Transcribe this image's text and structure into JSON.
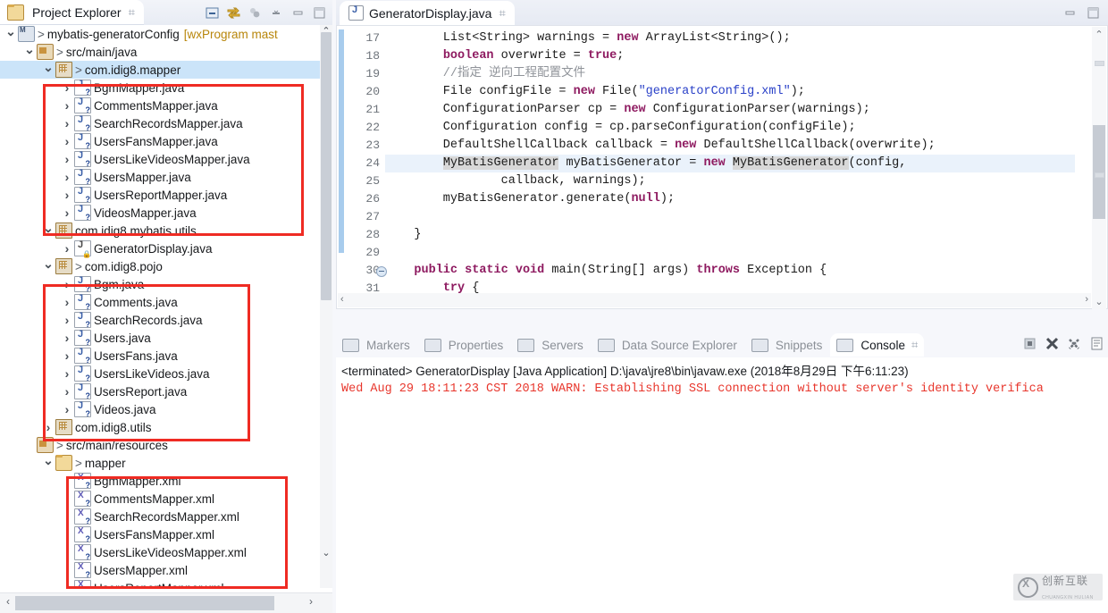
{
  "explorer": {
    "tab_title": "Project Explorer",
    "close_glyph": "⌗",
    "tools": [
      "collapse-all-icon",
      "link-with-editor-icon",
      "view-menu-icon",
      "minimize-icon",
      "maximize-icon"
    ],
    "tree": [
      {
        "label": "mybatis-generatorConfig",
        "suffix": "[wxProgram mast",
        "indent": 0,
        "arrow": "open",
        "icon": "ic-proj",
        "gt": true,
        "selected": false
      },
      {
        "label": "src/main/java",
        "suffix": "",
        "indent": 1,
        "arrow": "open",
        "icon": "ic-src",
        "gt": true,
        "selected": false
      },
      {
        "label": "com.idig8.mapper",
        "suffix": "",
        "indent": 2,
        "arrow": "open",
        "icon": "ic-pkg",
        "gt": true,
        "selected": true
      },
      {
        "label": "BgmMapper.java",
        "suffix": "",
        "indent": 3,
        "arrow": "closed",
        "icon": "ic-java",
        "gt": false,
        "selected": false
      },
      {
        "label": "CommentsMapper.java",
        "suffix": "",
        "indent": 3,
        "arrow": "closed",
        "icon": "ic-java",
        "gt": false,
        "selected": false
      },
      {
        "label": "SearchRecordsMapper.java",
        "suffix": "",
        "indent": 3,
        "arrow": "closed",
        "icon": "ic-java",
        "gt": false,
        "selected": false
      },
      {
        "label": "UsersFansMapper.java",
        "suffix": "",
        "indent": 3,
        "arrow": "closed",
        "icon": "ic-java",
        "gt": false,
        "selected": false
      },
      {
        "label": "UsersLikeVideosMapper.java",
        "suffix": "",
        "indent": 3,
        "arrow": "closed",
        "icon": "ic-java",
        "gt": false,
        "selected": false
      },
      {
        "label": "UsersMapper.java",
        "suffix": "",
        "indent": 3,
        "arrow": "closed",
        "icon": "ic-java",
        "gt": false,
        "selected": false
      },
      {
        "label": "UsersReportMapper.java",
        "suffix": "",
        "indent": 3,
        "arrow": "closed",
        "icon": "ic-java",
        "gt": false,
        "selected": false
      },
      {
        "label": "VideosMapper.java",
        "suffix": "",
        "indent": 3,
        "arrow": "closed",
        "icon": "ic-java",
        "gt": false,
        "selected": false
      },
      {
        "label": "com.idig8.mybatis.utils",
        "suffix": "",
        "indent": 2,
        "arrow": "open",
        "icon": "ic-pkg",
        "gt": false,
        "selected": false
      },
      {
        "label": "GeneratorDisplay.java",
        "suffix": "",
        "indent": 3,
        "arrow": "closed",
        "icon": "ic-java2",
        "gt": false,
        "selected": false
      },
      {
        "label": "com.idig8.pojo",
        "suffix": "",
        "indent": 2,
        "arrow": "open",
        "icon": "ic-pkg",
        "gt": true,
        "selected": false
      },
      {
        "label": "Bgm.java",
        "suffix": "",
        "indent": 3,
        "arrow": "closed",
        "icon": "ic-java",
        "gt": false,
        "selected": false
      },
      {
        "label": "Comments.java",
        "suffix": "",
        "indent": 3,
        "arrow": "closed",
        "icon": "ic-java",
        "gt": false,
        "selected": false
      },
      {
        "label": "SearchRecords.java",
        "suffix": "",
        "indent": 3,
        "arrow": "closed",
        "icon": "ic-java",
        "gt": false,
        "selected": false
      },
      {
        "label": "Users.java",
        "suffix": "",
        "indent": 3,
        "arrow": "closed",
        "icon": "ic-java",
        "gt": false,
        "selected": false
      },
      {
        "label": "UsersFans.java",
        "suffix": "",
        "indent": 3,
        "arrow": "closed",
        "icon": "ic-java",
        "gt": false,
        "selected": false
      },
      {
        "label": "UsersLikeVideos.java",
        "suffix": "",
        "indent": 3,
        "arrow": "closed",
        "icon": "ic-java",
        "gt": false,
        "selected": false
      },
      {
        "label": "UsersReport.java",
        "suffix": "",
        "indent": 3,
        "arrow": "closed",
        "icon": "ic-java",
        "gt": false,
        "selected": false
      },
      {
        "label": "Videos.java",
        "suffix": "",
        "indent": 3,
        "arrow": "closed",
        "icon": "ic-java",
        "gt": false,
        "selected": false
      },
      {
        "label": "com.idig8.utils",
        "suffix": "",
        "indent": 2,
        "arrow": "closed",
        "icon": "ic-pkg",
        "gt": false,
        "selected": false
      },
      {
        "label": "src/main/resources",
        "suffix": "",
        "indent": 1,
        "arrow": "blank",
        "icon": "ic-src",
        "gt": true,
        "selected": false
      },
      {
        "label": "mapper",
        "suffix": "",
        "indent": 2,
        "arrow": "open",
        "icon": "ic-folder",
        "gt": true,
        "selected": false
      },
      {
        "label": "BgmMapper.xml",
        "suffix": "",
        "indent": 3,
        "arrow": "blank",
        "icon": "ic-xml",
        "gt": false,
        "selected": false
      },
      {
        "label": "CommentsMapper.xml",
        "suffix": "",
        "indent": 3,
        "arrow": "blank",
        "icon": "ic-xml",
        "gt": false,
        "selected": false
      },
      {
        "label": "SearchRecordsMapper.xml",
        "suffix": "",
        "indent": 3,
        "arrow": "blank",
        "icon": "ic-xml",
        "gt": false,
        "selected": false
      },
      {
        "label": "UsersFansMapper.xml",
        "suffix": "",
        "indent": 3,
        "arrow": "blank",
        "icon": "ic-xml",
        "gt": false,
        "selected": false
      },
      {
        "label": "UsersLikeVideosMapper.xml",
        "suffix": "",
        "indent": 3,
        "arrow": "blank",
        "icon": "ic-xml",
        "gt": false,
        "selected": false
      },
      {
        "label": "UsersMapper.xml",
        "suffix": "",
        "indent": 3,
        "arrow": "blank",
        "icon": "ic-xml",
        "gt": false,
        "selected": false
      },
      {
        "label": "UsersReportMapper.xml",
        "suffix": "",
        "indent": 3,
        "arrow": "blank",
        "icon": "ic-xml",
        "gt": false,
        "selected": false
      }
    ],
    "scroll_left_glyph": "‹",
    "scroll_right_glyph": "›",
    "scroll_up_glyph": "⌃",
    "scroll_down_glyph": "⌄"
  },
  "editor": {
    "tab_title": "GeneratorDisplay.java",
    "close_glyph": "⌗",
    "minimize_glyph": "–",
    "maximize_glyph": "□",
    "first_line_number": 17,
    "highlight_line": 24,
    "fold_line": 30,
    "lines": [
      {
        "n": 17,
        "text": "        List<String> warnings = new ArrayList<String>();"
      },
      {
        "n": 18,
        "text": "        boolean overwrite = true;"
      },
      {
        "n": 19,
        "text": "        //指定 逆向工程配置文件"
      },
      {
        "n": 20,
        "text": "        File configFile = new File(\"generatorConfig.xml\");"
      },
      {
        "n": 21,
        "text": "        ConfigurationParser cp = new ConfigurationParser(warnings);"
      },
      {
        "n": 22,
        "text": "        Configuration config = cp.parseConfiguration(configFile);"
      },
      {
        "n": 23,
        "text": "        DefaultShellCallback callback = new DefaultShellCallback(overwrite);"
      },
      {
        "n": 24,
        "text": "        MyBatisGenerator myBatisGenerator = new MyBatisGenerator(config,"
      },
      {
        "n": 25,
        "text": "                callback, warnings);"
      },
      {
        "n": 26,
        "text": "        myBatisGenerator.generate(null);"
      },
      {
        "n": 27,
        "text": ""
      },
      {
        "n": 28,
        "text": "    }"
      },
      {
        "n": 29,
        "text": ""
      },
      {
        "n": 30,
        "text": "    public static void main(String[] args) throws Exception {"
      },
      {
        "n": 31,
        "text": "        try {"
      }
    ]
  },
  "console": {
    "tabs": [
      {
        "label": "Markers",
        "icon": "markers-icon",
        "active": false
      },
      {
        "label": "Properties",
        "icon": "properties-icon",
        "active": false
      },
      {
        "label": "Servers",
        "icon": "servers-icon",
        "active": false
      },
      {
        "label": "Data Source Explorer",
        "icon": "data-source-explorer-icon",
        "active": false
      },
      {
        "label": "Snippets",
        "icon": "snippets-icon",
        "active": false
      },
      {
        "label": "Console",
        "icon": "console-icon",
        "active": true
      }
    ],
    "close_glyph": "⌗",
    "tools": [
      "stop-icon",
      "clear-console-icon",
      "remove-all-terminated-icon",
      "display-selected-console-icon"
    ],
    "header": "<terminated> GeneratorDisplay [Java Application] D:\\java\\jre8\\bin\\javaw.exe (2018年8月29日 下午6:11:23)",
    "warning": "Wed Aug 29 18:11:23 CST 2018 WARN: Establishing SSL connection without server's identity verifica"
  },
  "watermark": {
    "title": "创新互联",
    "subtitle": "CHUANGXIN HULIAN"
  },
  "colors": {
    "selection": "#cbe4f9",
    "annotation_red": "#ef2b23",
    "keyword": "#8e1a60",
    "string": "#2a41c8",
    "comment": "#8f9399",
    "console_error": "#e8362c"
  }
}
